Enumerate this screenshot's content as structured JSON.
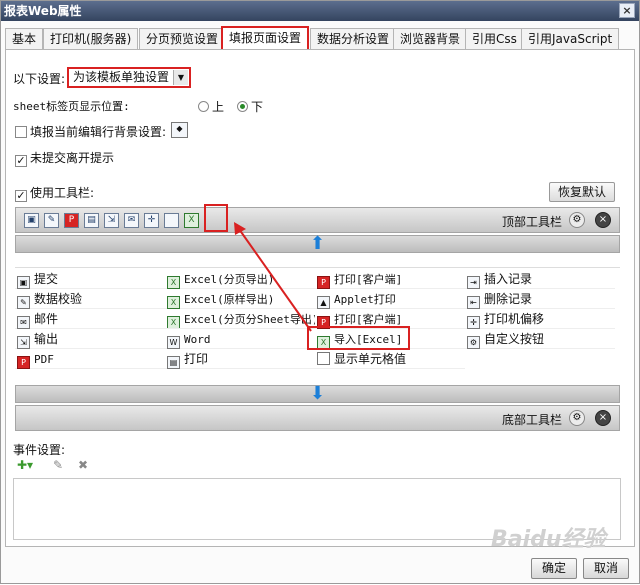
{
  "window": {
    "title": "报表Web属性",
    "close": "×"
  },
  "tabs": [
    {
      "label": "基本"
    },
    {
      "label": "打印机(服务器)"
    },
    {
      "label": "分页预览设置"
    },
    {
      "label": "填报页面设置"
    },
    {
      "label": "数据分析设置"
    },
    {
      "label": "浏览器背景"
    },
    {
      "label": "引用Css"
    },
    {
      "label": "引用JavaScript"
    }
  ],
  "settings": {
    "scope_label": "以下设置:",
    "scope_value": "为该模板单独设置",
    "sheet_tab_label": "sheet标签页显示位置:",
    "sheet_top": "上",
    "sheet_bottom": "下",
    "row_bg_label": "填报当前编辑行背景设置:",
    "unsubmitted_label": "未提交离开提示",
    "use_toolbar_label": "使用工具栏:",
    "restore_default": "恢复默认"
  },
  "top_toolbar": {
    "label": "顶部工具栏"
  },
  "bottom_toolbar": {
    "label": "底部工具栏"
  },
  "buttons_grid": {
    "col1": [
      "提交",
      "数据校验",
      "邮件",
      "输出",
      "PDF"
    ],
    "col2": [
      "Excel(分页导出)",
      "Excel(原样导出)",
      "Excel(分页分Sheet导出)",
      "Word",
      "打印"
    ],
    "col3": [
      "打印[客户端]",
      "Applet打印",
      "打印[客户端]",
      "导入[Excel]",
      "显示单元格值"
    ],
    "col4": [
      "插入记录",
      "删除记录",
      "打印机偏移",
      "自定义按钮"
    ]
  },
  "events": {
    "label": "事件设置:"
  },
  "footer": {
    "ok": "确定",
    "cancel": "取消"
  },
  "watermark": "Baidu经验",
  "colors": {
    "highlight": "#d92121",
    "arrow_blue": "#1c7fd8",
    "title_bar": "#34445f"
  }
}
